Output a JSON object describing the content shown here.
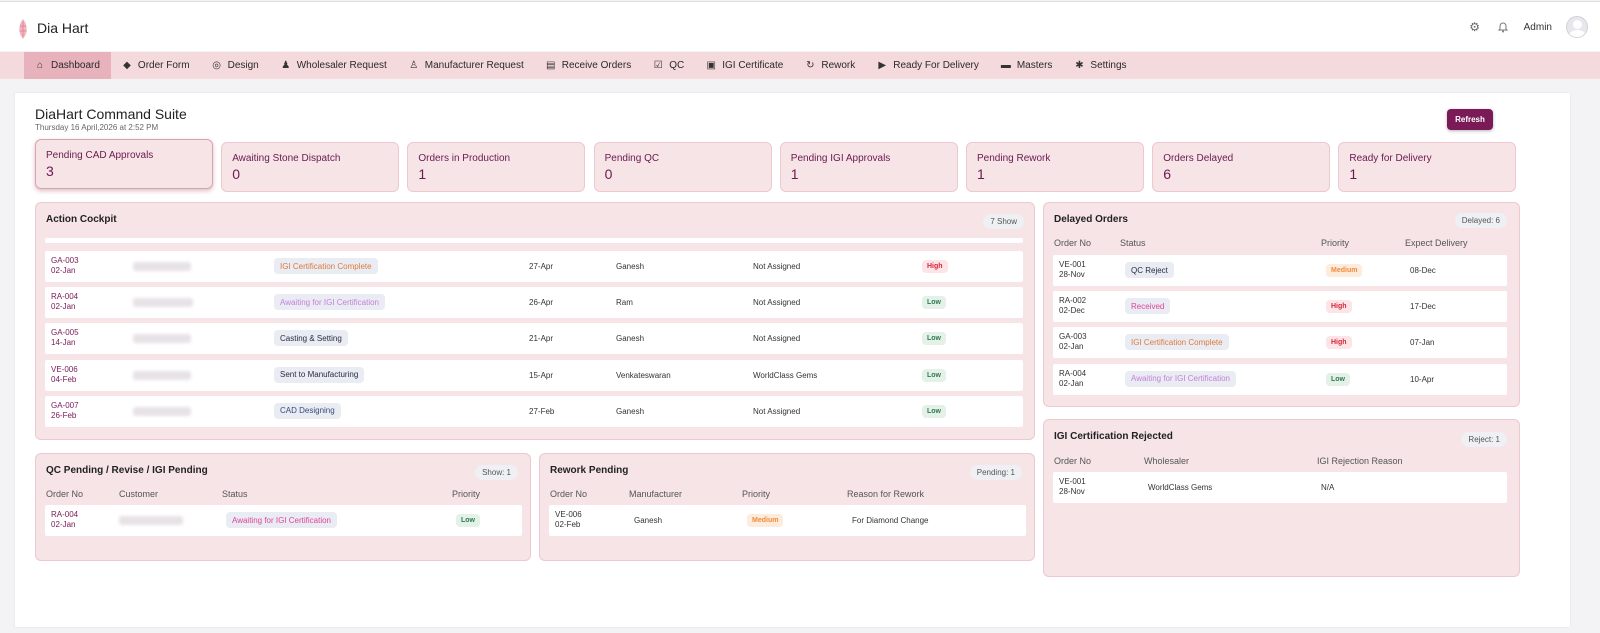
{
  "header": {
    "brand": "Dia Hart",
    "user": "Admin"
  },
  "nav": {
    "items": [
      {
        "label": "Dashboard",
        "icon": "home-icon",
        "glyph": "⌂"
      },
      {
        "label": "Order Form",
        "icon": "tag-icon",
        "glyph": "◆"
      },
      {
        "label": "Design",
        "icon": "ring-icon",
        "glyph": "◎"
      },
      {
        "label": "Wholesaler Request",
        "icon": "users-icon",
        "glyph": "♟"
      },
      {
        "label": "Manufacturer Request",
        "icon": "group-icon",
        "glyph": "♙"
      },
      {
        "label": "Receive Orders",
        "icon": "clipboard-icon",
        "glyph": "▤"
      },
      {
        "label": "QC",
        "icon": "checkbox-icon",
        "glyph": "☑"
      },
      {
        "label": "IGI Certificate",
        "icon": "certificate-icon",
        "glyph": "▣"
      },
      {
        "label": "Rework",
        "icon": "refresh-icon",
        "glyph": "↻"
      },
      {
        "label": "Ready For Delivery",
        "icon": "truck-icon",
        "glyph": "▶"
      },
      {
        "label": "Masters",
        "icon": "cart-icon",
        "glyph": "▬"
      },
      {
        "label": "Settings",
        "icon": "gear-icon",
        "glyph": "✱"
      }
    ]
  },
  "page": {
    "title": "DiaHart Command Suite",
    "subtitle": "Thursday 16 April,2026 at 2:52 PM",
    "refresh_label": "Refresh"
  },
  "stats": [
    {
      "label": "Pending CAD Approvals",
      "value": "3"
    },
    {
      "label": "Awaiting Stone Dispatch",
      "value": "0"
    },
    {
      "label": "Orders in Production",
      "value": "1"
    },
    {
      "label": "Pending QC",
      "value": "0"
    },
    {
      "label": "Pending IGI Approvals",
      "value": "1"
    },
    {
      "label": "Pending Rework",
      "value": "1"
    },
    {
      "label": "Orders Delayed",
      "value": "6"
    },
    {
      "label": "Ready for Delivery",
      "value": "1"
    }
  ],
  "cockpit": {
    "title": "Action Cockpit",
    "pill": "7 Show",
    "rows": [
      {
        "id": "GA-003",
        "date": "02-Jan",
        "status": "IGI Certification Complete",
        "status_tone": "orange",
        "due": "27-Apr",
        "person": "Ganesh",
        "assigned": "Not Assigned",
        "priority": "High"
      },
      {
        "id": "RA-004",
        "date": "02-Jan",
        "status": "Awaiting for IGI Certification",
        "status_tone": "lavender",
        "due": "26-Apr",
        "person": "Ram",
        "assigned": "Not Assigned",
        "priority": "Low"
      },
      {
        "id": "GA-005",
        "date": "14-Jan",
        "status": "Casting & Setting",
        "status_tone": "dark",
        "due": "21-Apr",
        "person": "Ganesh",
        "assigned": "Not Assigned",
        "priority": "Low"
      },
      {
        "id": "VE-006",
        "date": "04-Feb",
        "status": "Sent to Manufacturing",
        "status_tone": "dark",
        "due": "15-Apr",
        "person": "Venkateswaran",
        "assigned": "WorldClass Gems",
        "priority": "Low"
      },
      {
        "id": "GA-007",
        "date": "26-Feb",
        "status": "CAD Designing",
        "status_tone": "navy",
        "due": "27-Feb",
        "person": "Ganesh",
        "assigned": "Not Assigned",
        "priority": "Low"
      }
    ]
  },
  "delayed": {
    "title": "Delayed Orders",
    "pill": "Delayed: 6",
    "columns": [
      "Order No",
      "Status",
      "Priority",
      "Expect Delivery"
    ],
    "rows": [
      {
        "id": "VE-001",
        "date": "28-Nov",
        "status": "QC Reject",
        "status_tone": "dark",
        "priority": "Medium",
        "delivery": "08-Dec"
      },
      {
        "id": "RA-002",
        "date": "02-Dec",
        "status": "Received",
        "status_tone": "pink",
        "priority": "High",
        "delivery": "17-Dec"
      },
      {
        "id": "GA-003",
        "date": "02-Jan",
        "status": "IGI Certification Complete",
        "status_tone": "orange",
        "priority": "High",
        "delivery": "07-Jan"
      },
      {
        "id": "RA-004",
        "date": "02-Jan",
        "status": "Awaiting for IGI Certification",
        "status_tone": "lavender",
        "priority": "Low",
        "delivery": "10-Apr"
      }
    ]
  },
  "qc": {
    "title": "QC Pending / Revise / IGI Pending",
    "pill": "Show: 1",
    "columns": [
      "Order No",
      "Customer",
      "Status",
      "Priority"
    ],
    "rows": [
      {
        "id": "RA-004",
        "date": "02-Jan",
        "status": "Awaiting for IGI Certification",
        "status_tone": "pink",
        "priority": "Low"
      }
    ]
  },
  "rework": {
    "title": "Rework Pending",
    "pill": "Pending: 1",
    "columns": [
      "Order No",
      "Manufacturer",
      "Priority",
      "Reason for Rework"
    ],
    "rows": [
      {
        "id": "VE-006",
        "date": "02-Feb",
        "manufacturer": "Ganesh",
        "priority": "Medium",
        "reason": "For Diamond Change"
      }
    ]
  },
  "igi_rejected": {
    "title": "IGI Certification Rejected",
    "pill": "Reject: 1",
    "columns": [
      "Order No",
      "Wholesaler",
      "IGI Rejection Reason"
    ],
    "rows": [
      {
        "id": "VE-001",
        "date": "28-Nov",
        "wholesaler": "WorldClass Gems",
        "reason": "N/A"
      }
    ]
  },
  "colors": {
    "accent": "#7a1a57",
    "nav_bg": "#f4d9dd",
    "nav_active": "#e7b2bb",
    "card_bg": "#f6e4e7",
    "priority_high": "#d3273a",
    "priority_low": "#2f7a4e",
    "priority_medium": "#ee8b3c"
  }
}
